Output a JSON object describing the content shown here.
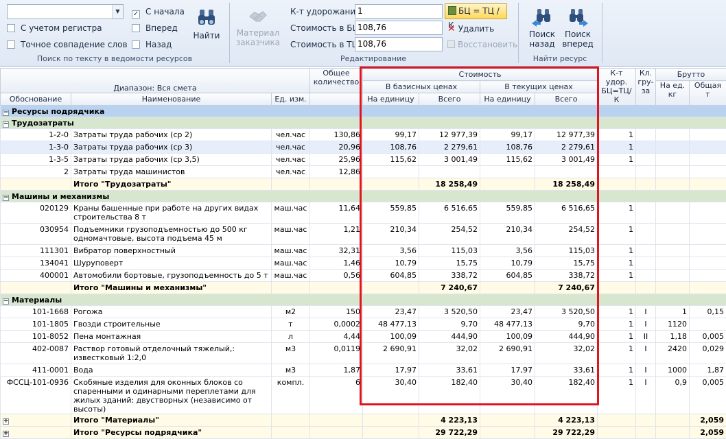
{
  "search": {
    "combo_value": "",
    "match_case_label": "С учетом регистра",
    "exact_match_label": "Точное совпадение слов",
    "from_start_label": "С начала",
    "from_start_checked": "✓",
    "forward_label": "Вперед",
    "back_label": "Назад",
    "find_button": "Найти",
    "group_caption": "Поиск по тексту в ведомости ресурсов"
  },
  "edit": {
    "customer_material_line1": "Материал",
    "customer_material_line2": "заказчика",
    "coef_label": "К-т удорожания",
    "coef_value": "1",
    "cost_bc_label": "Стоимость в БЦ",
    "cost_bc_value": "108,76",
    "cost_tc_label": "Стоимость в ТЦ",
    "cost_tc_value": "108,76",
    "bc_button": "БЦ = ТЦ / К",
    "delete_label": "Удалить",
    "restore_label": "Восстановить",
    "group_caption": "Редактирование"
  },
  "find_resource": {
    "back_line1": "Поиск",
    "back_line2": "назад",
    "forward_line1": "Поиск",
    "forward_line2": "вперед",
    "group_caption": "Найти ресурс"
  },
  "header": {
    "range": "Диапазон: Вся смета",
    "basis": "Обоснование",
    "name": "Наименование",
    "unit": "Ед. изм.",
    "total_qty": "Общее количество",
    "cost": "Стоимость",
    "base_prices": "В базисных ценах",
    "current_prices": "В текущих ценах",
    "per_unit": "На единицу",
    "total": "Всего",
    "coef": "К-т удор. БЦ=ТЦ/К",
    "cargo_class": "Кл. гру-за",
    "gross": "Брутто",
    "gross_per_unit": "На ед. кг",
    "gross_total": "Общая т"
  },
  "rows": [
    {
      "kind": "main",
      "label": "Ресурсы подрядчика",
      "toggle": "−"
    },
    {
      "kind": "sub",
      "label": "Трудозатраты",
      "toggle": "−"
    },
    {
      "kind": "item",
      "code": "1-2-0",
      "name": "Затраты труда рабочих (ср 2)",
      "unit": "чел.час",
      "qty": "130,86",
      "bu": "99,17",
      "bt": "12 977,39",
      "cu": "99,17",
      "ct": "12 977,39",
      "k": "1",
      "cl": "",
      "gu": "",
      "gt": ""
    },
    {
      "kind": "item",
      "sel": true,
      "code": "1-3-0",
      "name": "Затраты труда рабочих (ср 3)",
      "unit": "чел.час",
      "qty": "20,96",
      "bu": "108,76",
      "bt": "2 279,61",
      "cu": "108,76",
      "ct": "2 279,61",
      "k": "1",
      "cl": "",
      "gu": "",
      "gt": ""
    },
    {
      "kind": "item",
      "code": "1-3-5",
      "name": "Затраты труда рабочих (ср 3,5)",
      "unit": "чел.час",
      "qty": "25,96",
      "bu": "115,62",
      "bt": "3 001,49",
      "cu": "115,62",
      "ct": "3 001,49",
      "k": "1",
      "cl": "",
      "gu": "",
      "gt": ""
    },
    {
      "kind": "item",
      "code": "2",
      "name": "Затраты труда машинистов",
      "unit": "чел.час",
      "qty": "12,86",
      "bu": "",
      "bt": "",
      "cu": "",
      "ct": "",
      "k": "",
      "cl": "",
      "gu": "",
      "gt": ""
    },
    {
      "kind": "total",
      "label": "Итого \"Трудозатраты\"",
      "bt": "18 258,49",
      "ct": "18 258,49",
      "gt": ""
    },
    {
      "kind": "sub",
      "label": "Машины и механизмы",
      "toggle": "−"
    },
    {
      "kind": "item",
      "tall": true,
      "code": "020129",
      "name": "Краны башенные при работе на других видах строительства 8 т",
      "unit": "маш.час",
      "qty": "11,64",
      "bu": "559,85",
      "bt": "6 516,65",
      "cu": "559,85",
      "ct": "6 516,65",
      "k": "1",
      "cl": "",
      "gu": "",
      "gt": ""
    },
    {
      "kind": "item",
      "tall": true,
      "code": "030954",
      "name": "Подъемники грузоподъемностью до 500 кг одномачтовые, высота подъема 45 м",
      "unit": "маш.час",
      "qty": "1,21",
      "bu": "210,34",
      "bt": "254,52",
      "cu": "210,34",
      "ct": "254,52",
      "k": "1",
      "cl": "",
      "gu": "",
      "gt": ""
    },
    {
      "kind": "item",
      "code": "111301",
      "name": "Вибратор поверхностный",
      "unit": "маш.час",
      "qty": "32,31",
      "bu": "3,56",
      "bt": "115,03",
      "cu": "3,56",
      "ct": "115,03",
      "k": "1",
      "cl": "",
      "gu": "",
      "gt": ""
    },
    {
      "kind": "item",
      "code": "134041",
      "name": "Шуруповерт",
      "unit": "маш.час",
      "qty": "1,46",
      "bu": "10,79",
      "bt": "15,75",
      "cu": "10,79",
      "ct": "15,75",
      "k": "1",
      "cl": "",
      "gu": "",
      "gt": ""
    },
    {
      "kind": "item",
      "code": "400001",
      "name": "Автомобили бортовые, грузоподъемность до 5 т",
      "unit": "маш.час",
      "qty": "0,56",
      "bu": "604,85",
      "bt": "338,72",
      "cu": "604,85",
      "ct": "338,72",
      "k": "1",
      "cl": "",
      "gu": "",
      "gt": ""
    },
    {
      "kind": "total",
      "label": "Итого \"Машины и механизмы\"",
      "bt": "7 240,67",
      "ct": "7 240,67",
      "gt": ""
    },
    {
      "kind": "sub",
      "label": "Материалы",
      "toggle": "−"
    },
    {
      "kind": "item",
      "code": "101-1668",
      "name": "Рогожа",
      "unit": "м2",
      "qty": "150",
      "bu": "23,47",
      "bt": "3 520,50",
      "cu": "23,47",
      "ct": "3 520,50",
      "k": "1",
      "cl": "I",
      "gu": "1",
      "gt": "0,15"
    },
    {
      "kind": "item",
      "code": "101-1805",
      "name": "Гвозди строительные",
      "unit": "т",
      "qty": "0,0002",
      "bu": "48 477,13",
      "bt": "9,70",
      "cu": "48 477,13",
      "ct": "9,70",
      "k": "1",
      "cl": "I",
      "gu": "1120",
      "gt": ""
    },
    {
      "kind": "item",
      "code": "101-8052",
      "name": "Пена монтажная",
      "unit": "л",
      "qty": "4,44",
      "bu": "100,09",
      "bt": "444,90",
      "cu": "100,09",
      "ct": "444,90",
      "k": "1",
      "cl": "II",
      "gu": "1,18",
      "gt": "0,005"
    },
    {
      "kind": "item",
      "tall": true,
      "code": "402-0087",
      "name": "Раствор готовый отделочный тяжелый,: известковый 1:2,0",
      "unit": "м3",
      "qty": "0,0119",
      "bu": "2 690,91",
      "bt": "32,02",
      "cu": "2 690,91",
      "ct": "32,02",
      "k": "1",
      "cl": "I",
      "gu": "2420",
      "gt": "0,029"
    },
    {
      "kind": "item",
      "code": "411-0001",
      "name": "Вода",
      "unit": "м3",
      "qty": "1,87",
      "bu": "17,97",
      "bt": "33,61",
      "cu": "17,97",
      "ct": "33,61",
      "k": "1",
      "cl": "I",
      "gu": "1000",
      "gt": "1,87"
    },
    {
      "kind": "item",
      "tall3": true,
      "code": "ФССЦ-101-0936",
      "name": "Скобяные изделия для оконных блоков со спаренными и одинарными переплетами для жилых зданий: двустворных (независимо от высоты)",
      "unit": "компл.",
      "qty": "6",
      "bu": "30,40",
      "bt": "182,40",
      "cu": "30,40",
      "ct": "182,40",
      "k": "1",
      "cl": "I",
      "gu": "0,9",
      "gt": "0,005"
    },
    {
      "kind": "total",
      "toggle": "+",
      "label": "Итого \"Материалы\"",
      "bt": "4 223,13",
      "ct": "4 223,13",
      "gt": "2,059"
    },
    {
      "kind": "total",
      "toggle": "+",
      "label": "Итого \"Ресурсы подрядчика\"",
      "bt": "29 722,29",
      "ct": "29 722,29",
      "gt": "2,059"
    }
  ]
}
